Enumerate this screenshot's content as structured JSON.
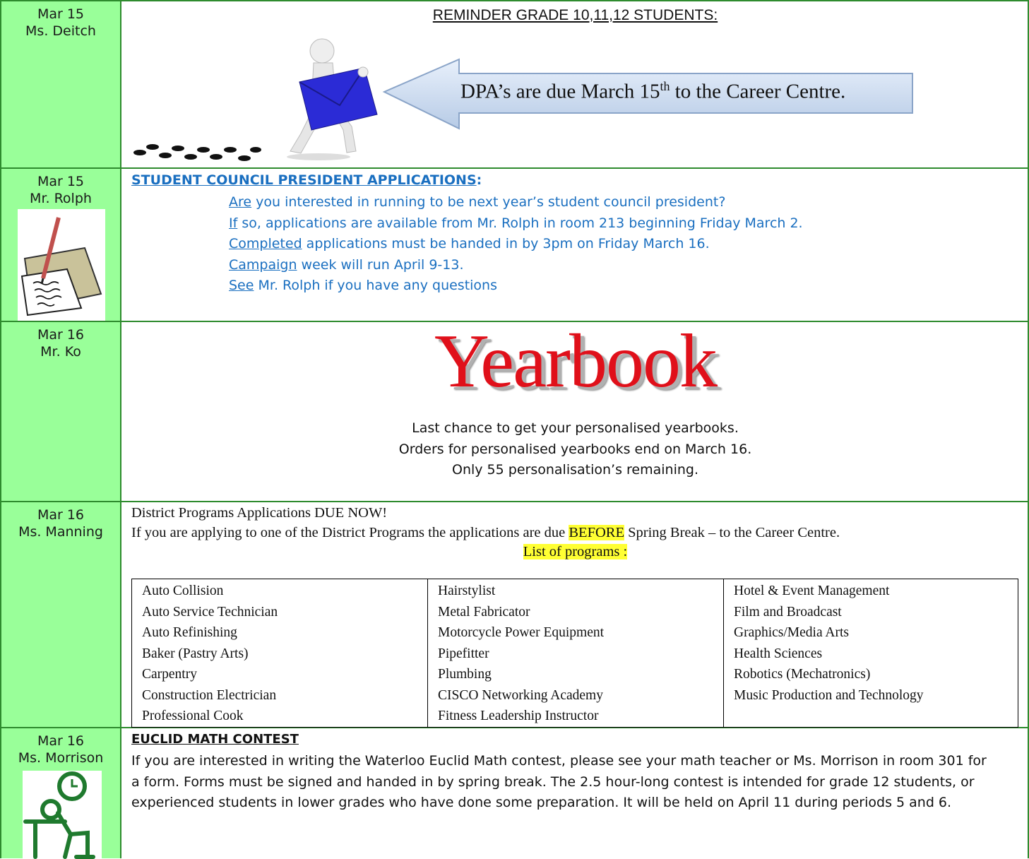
{
  "rows": [
    {
      "date": "Mar 15",
      "teacher": "Ms. Deitch",
      "heading": "REMINDER GRADE 10,11,12 STUDENTS:",
      "callout_prefix": "DPA’s are due March 15",
      "callout_sup": "th",
      "callout_suffix": " to the Career Centre."
    },
    {
      "date": "Mar 15",
      "teacher": "Mr. Rolph",
      "heading": "STUDENT COUNCIL PRESIDENT APPLICATIONS",
      "heading_colon": ":",
      "lines": [
        {
          "first": "Are",
          "rest": " you interested in running to be next year’s student council president?"
        },
        {
          "first": "If",
          "rest": " so, applications are available from Mr. Rolph in room 213 beginning Friday March 2."
        },
        {
          "first": "Completed",
          "rest": " applications must be handed in by 3pm on Friday March 16."
        },
        {
          "first": "Campaign",
          "rest": " week will run April 9-13."
        },
        {
          "first": "See",
          "rest": " Mr. Rolph if you have any questions"
        }
      ]
    },
    {
      "date": "Mar 16",
      "teacher": "Mr. Ko",
      "wordart": "Yearbook",
      "lines": [
        "Last chance to get your personalised yearbooks.",
        "Orders for personalised yearbooks end on March 16.",
        "Only 55 personalisation’s remaining."
      ]
    },
    {
      "date": "Mar 16",
      "teacher": "Ms. Manning",
      "line1": "District Programs Applications DUE NOW!",
      "line2_prefix": "If you are applying to one of the District Programs the applications are due ",
      "line2_highlight": "BEFORE",
      "line2_suffix": " Spring Break – to the Career Centre.",
      "list_label": "List of programs :",
      "columns": [
        [
          "Auto Collision",
          "Auto Service Technician",
          "Auto Refinishing",
          "Baker (Pastry Arts)",
          "Carpentry",
          "Construction Electrician",
          "Professional Cook"
        ],
        [
          "Hairstylist",
          "Metal Fabricator",
          "Motorcycle Power Equipment",
          "Pipefitter",
          "Plumbing",
          "CISCO Networking Academy",
          "Fitness Leadership Instructor"
        ],
        [
          "Hotel & Event Management",
          "Film and Broadcast",
          "Graphics/Media Arts",
          "Health Sciences",
          "Robotics (Mechatronics)",
          "Music Production and Technology"
        ]
      ]
    },
    {
      "date": "Mar 16",
      "teacher": "Ms. Morrison",
      "heading": "EUCLID MATH CONTEST",
      "lines": [
        "If you are interested in writing the Waterloo Euclid Math contest, please see your math teacher or Ms. Morrison in room 301 for",
        "a form.  Forms must be signed and handed in by spring break.  The 2.5 hour-long contest is intended for grade 12 students, or",
        "experienced students in lower grades who have done some preparation.  It will be held on April 11 during periods 5 and 6."
      ]
    }
  ]
}
